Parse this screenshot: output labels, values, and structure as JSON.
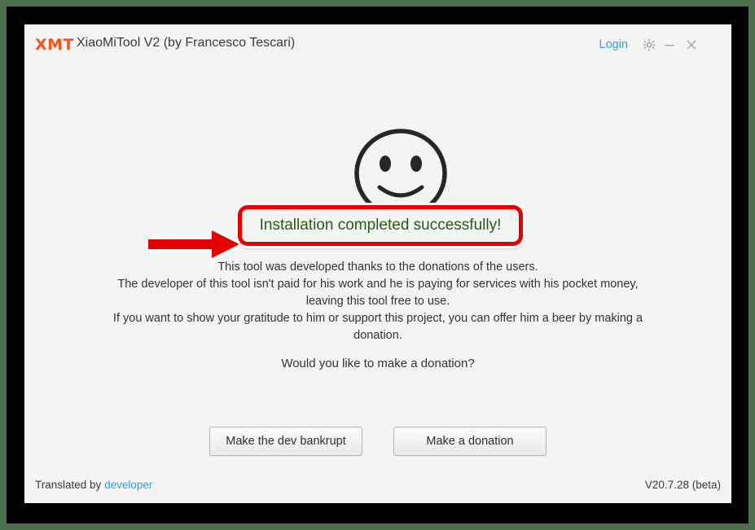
{
  "window": {
    "logo_text": "XMT",
    "title": "XiaoMiTool V2 (by Francesco Tescari)",
    "login_label": "Login",
    "gear_icon": "gear-icon",
    "minimize_icon": "minimize-icon",
    "close_icon": "close-icon"
  },
  "content": {
    "smiley_icon": "smiley-face-icon",
    "status_message": "Installation completed successfully!",
    "paragraph_lines": [
      "This tool was developed thanks to the donations of the users.",
      "The developer of this tool isn't paid for his work and he is paying for services with his pocket money,",
      "leaving this tool free to use.",
      "If you want to show your gratitude to him or support this project, you can offer him a beer by making a",
      "donation."
    ],
    "question": "Would you like to make a donation?"
  },
  "buttons": {
    "bankrupt_label": "Make the dev bankrupt",
    "donate_label": "Make a donation"
  },
  "footer": {
    "translated_prefix": "Translated by",
    "translator_link": "developer",
    "version": "V20.7.28 (beta)"
  },
  "annotation": {
    "arrow_icon": "red-arrow-icon",
    "highlight_color": "#e60000",
    "status_text_color": "#255c18"
  },
  "colors": {
    "brand_orange": "#f1551f",
    "link_blue": "#2aa3e0",
    "window_bg": "#f4f4f4",
    "frame_black": "#000000",
    "desktop_green": "#4a6f4a"
  }
}
